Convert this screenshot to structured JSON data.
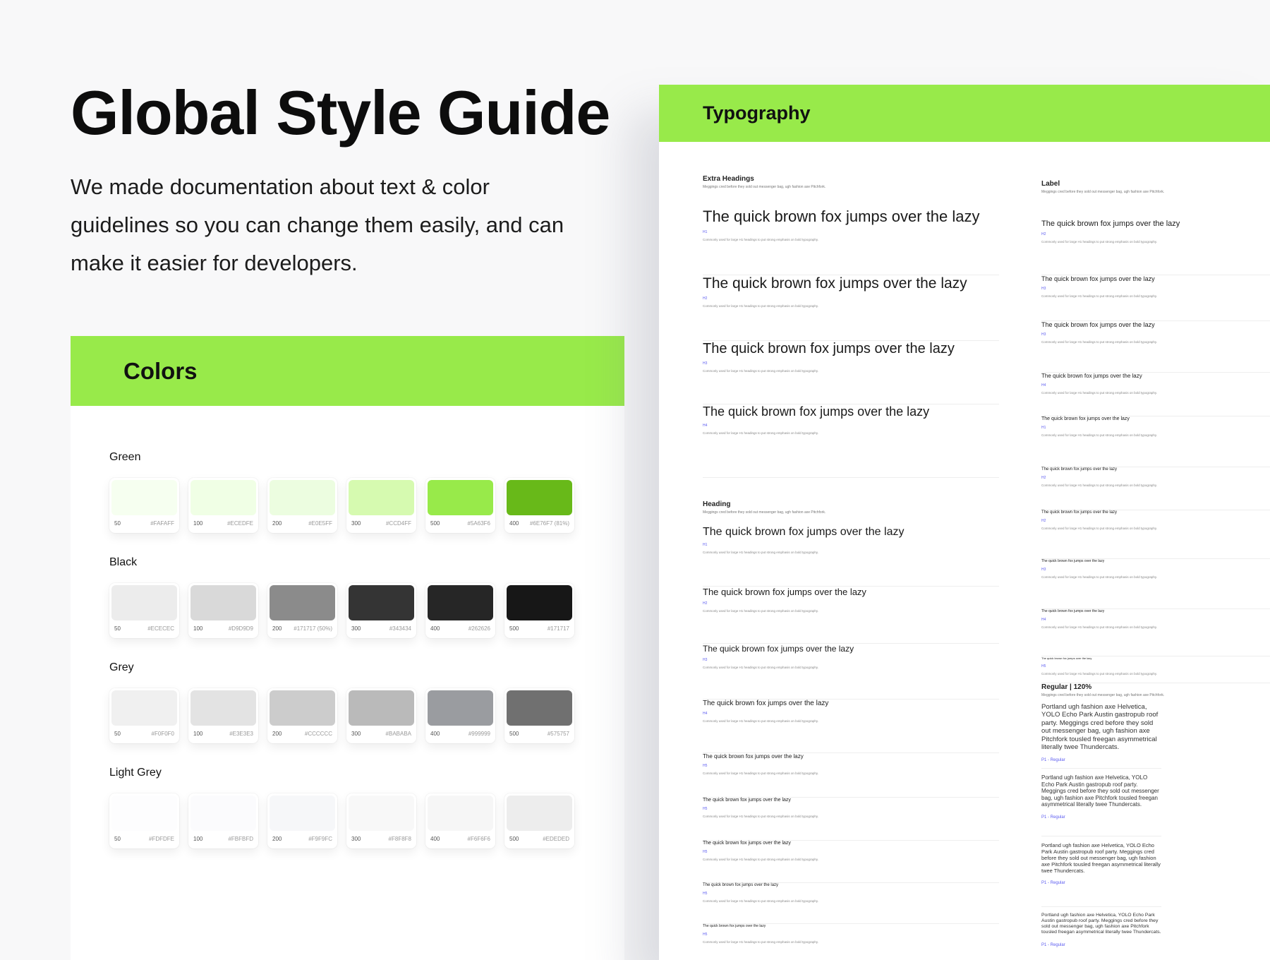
{
  "title": "Global Style Guide",
  "description": "We made documentation about text & color guidelines so you can change them easily, and can make it easier for developers.",
  "colors_panel": {
    "title": "Colors",
    "groups": [
      {
        "name": "Green",
        "swatches": [
          {
            "step": "50",
            "hex": "#FAFAFF",
            "color": "#f6fff0"
          },
          {
            "step": "100",
            "hex": "#ECEDFE",
            "color": "#f0ffe5"
          },
          {
            "step": "200",
            "hex": "#E0E5FF",
            "color": "#ecfde0"
          },
          {
            "step": "300",
            "hex": "#CCD4FF",
            "color": "#d6fab0"
          },
          {
            "step": "500",
            "hex": "#5A63F6",
            "color": "#98ea4a"
          },
          {
            "step": "400",
            "hex": "#6E76F7 (81%)",
            "color": "#68b919"
          }
        ]
      },
      {
        "name": "Black",
        "swatches": [
          {
            "step": "50",
            "hex": "#ECECEC",
            "color": "#ececec"
          },
          {
            "step": "100",
            "hex": "#D9D9D9",
            "color": "#d9d9d9"
          },
          {
            "step": "200",
            "hex": "#171717 (50%)",
            "color": "#8b8b8b"
          },
          {
            "step": "300",
            "hex": "#343434",
            "color": "#343434"
          },
          {
            "step": "400",
            "hex": "#262626",
            "color": "#262626"
          },
          {
            "step": "500",
            "hex": "#171717",
            "color": "#171717"
          }
        ]
      },
      {
        "name": "Grey",
        "swatches": [
          {
            "step": "50",
            "hex": "#F0F0F0",
            "color": "#f0f0f0"
          },
          {
            "step": "100",
            "hex": "#E3E3E3",
            "color": "#e3e3e3"
          },
          {
            "step": "200",
            "hex": "#CCCCCC",
            "color": "#cccccc"
          },
          {
            "step": "300",
            "hex": "#BABABA",
            "color": "#bababa"
          },
          {
            "step": "400",
            "hex": "#999999",
            "color": "#9a9ca0"
          },
          {
            "step": "500",
            "hex": "#575757",
            "color": "#707070"
          }
        ]
      },
      {
        "name": "Light Grey",
        "swatches": [
          {
            "step": "50",
            "hex": "#FDFDFE",
            "color": "#fdfdfe"
          },
          {
            "step": "100",
            "hex": "#FBFBFD",
            "color": "#fbfbfd"
          },
          {
            "step": "200",
            "hex": "#F9F9FC",
            "color": "#f6f7f9"
          },
          {
            "step": "300",
            "hex": "#F8F8F8",
            "color": "#f8f8f8"
          },
          {
            "step": "400",
            "hex": "#F6F6F6",
            "color": "#f6f6f6"
          },
          {
            "step": "500",
            "hex": "#EDEDED",
            "color": "#ededed"
          }
        ]
      }
    ]
  },
  "typography_panel": {
    "title": "Typography",
    "sample_text": "The quick brown fox jumps over the lazy",
    "note": "Commonly used for large H1 headings to put strong emphasis on bold typography.",
    "subtitle": "Meggings cred before they sold out messenger bag, ugh fashion axe Pitchfork.",
    "extra_headings": {
      "label": "Extra Headings",
      "tags": [
        "H1",
        "H2",
        "H3",
        "H4"
      ]
    },
    "heading": {
      "label": "Heading",
      "tags": [
        "H1",
        "H2",
        "H3",
        "H4",
        "H5",
        "H5",
        "H5",
        "H5",
        "H5"
      ]
    },
    "label_section": {
      "label": "Label",
      "tags": [
        "H2",
        "H3",
        "H3",
        "H4",
        "H1",
        "H2",
        "H2",
        "H3",
        "H4",
        "H5"
      ]
    },
    "regular": {
      "label": "Regular | 120%",
      "paragraph": "Portland ugh fashion axe Helvetica, YOLO Echo Park Austin gastropub roof party. Meggings cred before they sold out messenger bag, ugh fashion axe Pitchfork tousled freegan asymmetrical literally twee Thundercats.",
      "tag": "P1 - Regular"
    }
  }
}
